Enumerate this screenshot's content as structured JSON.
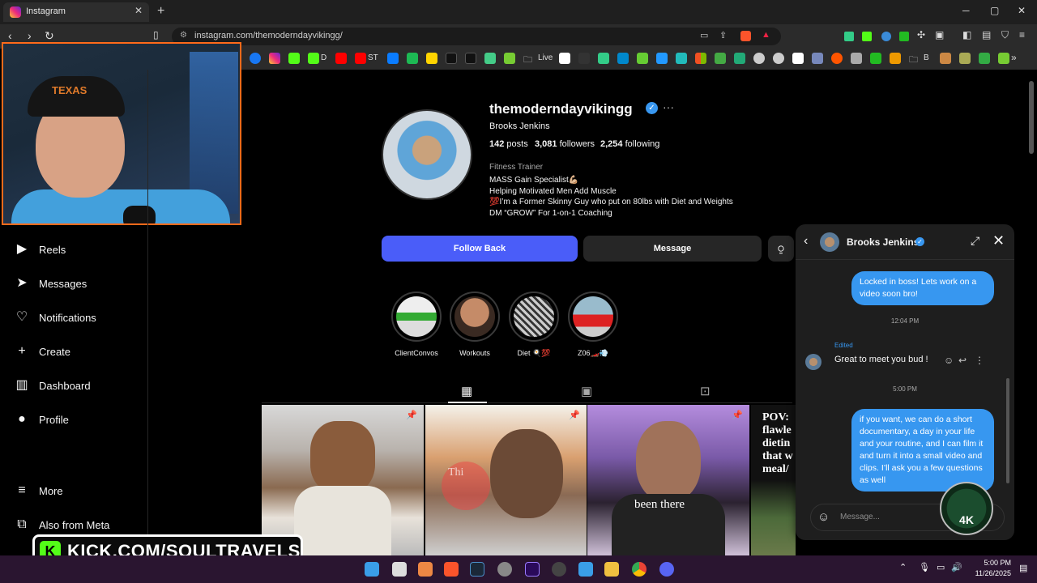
{
  "browser": {
    "tab_title": "Instagram",
    "url": "instagram.com/themoderndayvikingg/",
    "bookmarks": [
      "D",
      "ST",
      "Live",
      "B"
    ]
  },
  "sidebar": {
    "items": [
      {
        "label": "Reels",
        "icon": "reels-icon",
        "glyph": "▶"
      },
      {
        "label": "Messages",
        "icon": "messages-icon",
        "glyph": "➤"
      },
      {
        "label": "Notifications",
        "icon": "heart-icon",
        "glyph": "♡"
      },
      {
        "label": "Create",
        "icon": "plus-icon",
        "glyph": "+"
      },
      {
        "label": "Dashboard",
        "icon": "dashboard-icon",
        "glyph": "▥"
      },
      {
        "label": "Profile",
        "icon": "profile-avatar-icon",
        "glyph": "●"
      },
      {
        "label": "More",
        "icon": "menu-icon",
        "glyph": "≡"
      },
      {
        "label": "Also from Meta",
        "icon": "meta-icon",
        "glyph": "⧉"
      }
    ]
  },
  "profile": {
    "username": "themoderndayvikingg",
    "full_name": "Brooks Jenkins",
    "posts": "142",
    "posts_label": "posts",
    "followers": "3,081",
    "followers_label": "followers",
    "following": "2,254",
    "following_label": "following",
    "category": "Fitness Trainer",
    "bio": [
      "MASS Gain Specialist💪🏼",
      "Helping Motivated Men Add Muscle",
      "💯I’m a Former Skinny Guy who put on 80lbs with Diet and Weights",
      "DM “GROW” For 1-on-1 Coaching"
    ],
    "follow_back_label": "Follow Back",
    "message_label": "Message",
    "highlights": [
      "ClientConvos",
      "Workouts",
      "Diet 🍳💯",
      "Z06🏎️💨"
    ]
  },
  "posts": [
    {
      "overlay": ""
    },
    {
      "overlay": "Thi"
    },
    {
      "overlay": "been there"
    },
    {
      "overlay": "POV: flawle dietin that w meal/"
    }
  ],
  "chat": {
    "name": "Brooks Jenkins",
    "messages": {
      "out_1": "Locked in boss! Lets work on a video soon bro!",
      "time_1": "12:04 PM",
      "edited": "Edited",
      "in_1": "Great to meet you bud !",
      "time_2": "5:00 PM",
      "out_2": "if you want, we can do a short documentary, a day in your life and your routine, and I can film it and turn it into a small video and clips. I’ll ask you a few questions as well"
    },
    "placeholder": "Message...",
    "overlay_logo": "4K"
  },
  "stream": {
    "kick_text": "KICK.COM/SOULTRAVELS",
    "cam_cap_text": "TEXAS"
  },
  "taskbar": {
    "time": "5:00 PM",
    "date": "11/26/2025"
  },
  "colors": {
    "accent": "#4a5df9",
    "bubble": "#3797f0",
    "kick": "#53fc18",
    "webcam_border": "#ff6a1a"
  }
}
